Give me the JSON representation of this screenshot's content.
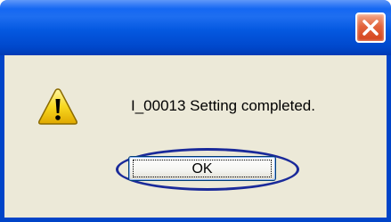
{
  "window": {
    "title": "",
    "title_color": "#0054e3",
    "client_color": "#ece9d8"
  },
  "close_button": {
    "icon": "close-icon",
    "color": "#d4441c"
  },
  "dialog": {
    "icon": "warning-icon",
    "message": "I_00013 Setting completed.",
    "ok_label": "OK",
    "highlight_color": "#1a2a9a"
  }
}
